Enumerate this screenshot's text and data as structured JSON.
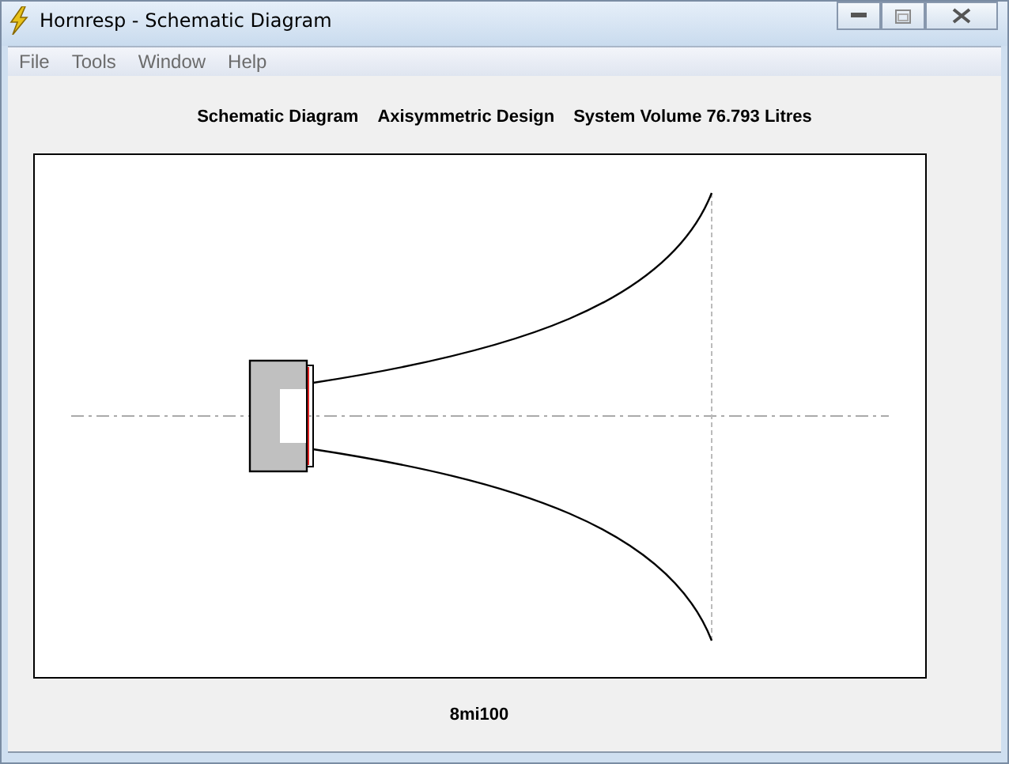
{
  "window": {
    "title": "Hornresp - Schematic Diagram"
  },
  "menu": [
    "File",
    "Tools",
    "Window",
    "Help"
  ],
  "header": [
    "Schematic Diagram",
    "Axisymmetric Design",
    "System Volume 76.793 Litres"
  ],
  "footer": "8mi100"
}
